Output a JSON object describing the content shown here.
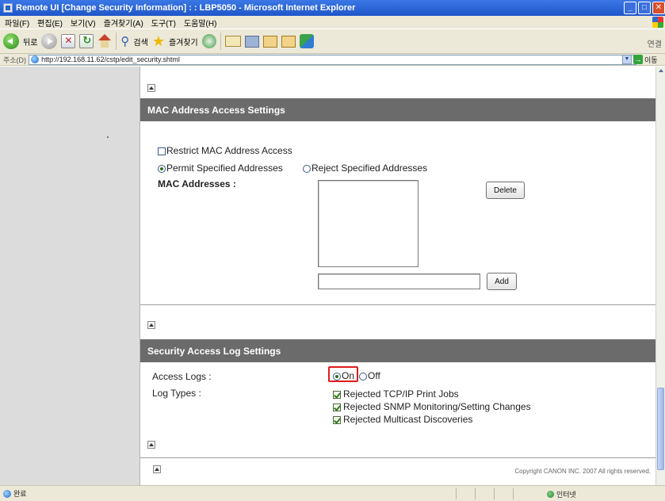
{
  "window": {
    "title": "Remote UI [Change Security Information] : : LBP5050 - Microsoft Internet Explorer",
    "minimize": "_",
    "maximize": "□",
    "close": "✕"
  },
  "menu": {
    "items": [
      "파일(F)",
      "편집(E)",
      "보기(V)",
      "즐겨찾기(A)",
      "도구(T)",
      "도움말(H)"
    ]
  },
  "toolbar": {
    "back_label": "뒤로",
    "search_label": "검색",
    "favorites_label": "즐겨찾기",
    "links_label": "연결"
  },
  "address": {
    "label": "주소(D)",
    "url": "http://192.168.11.62/cstp/edit_security.shtml",
    "go_label": "이동"
  },
  "mac_section": {
    "title": "MAC Address Access Settings",
    "restrict_label": "Restrict MAC Address Access",
    "restrict_checked": false,
    "permit_label": "Permit Specified Addresses",
    "reject_label": "Reject Specified Addresses",
    "selected_mode": "permit",
    "addresses_label": "MAC Addresses :",
    "addresses": [],
    "new_address_value": "",
    "delete_button": "Delete",
    "add_button": "Add"
  },
  "log_section": {
    "title": "Security Access Log Settings",
    "access_logs_label": "Access Logs :",
    "on_label": "On",
    "off_label": "Off",
    "selected": "on",
    "log_types_label": "Log Types :",
    "log_types": [
      {
        "label": "Rejected TCP/IP Print Jobs",
        "checked": true
      },
      {
        "label": "Rejected SNMP Monitoring/Setting Changes",
        "checked": true
      },
      {
        "label": "Rejected Multicast Discoveries",
        "checked": true
      }
    ]
  },
  "footer": {
    "copyright": "Copyright CANON INC. 2007 All rights reserved."
  },
  "status": {
    "text": "완료",
    "zone": "인터넷"
  },
  "colors": {
    "section_header": "#6b6b6b",
    "left_nav": "#dcdcdc",
    "highlight": "#e01c1c",
    "titlebar": "#1f56c8"
  }
}
